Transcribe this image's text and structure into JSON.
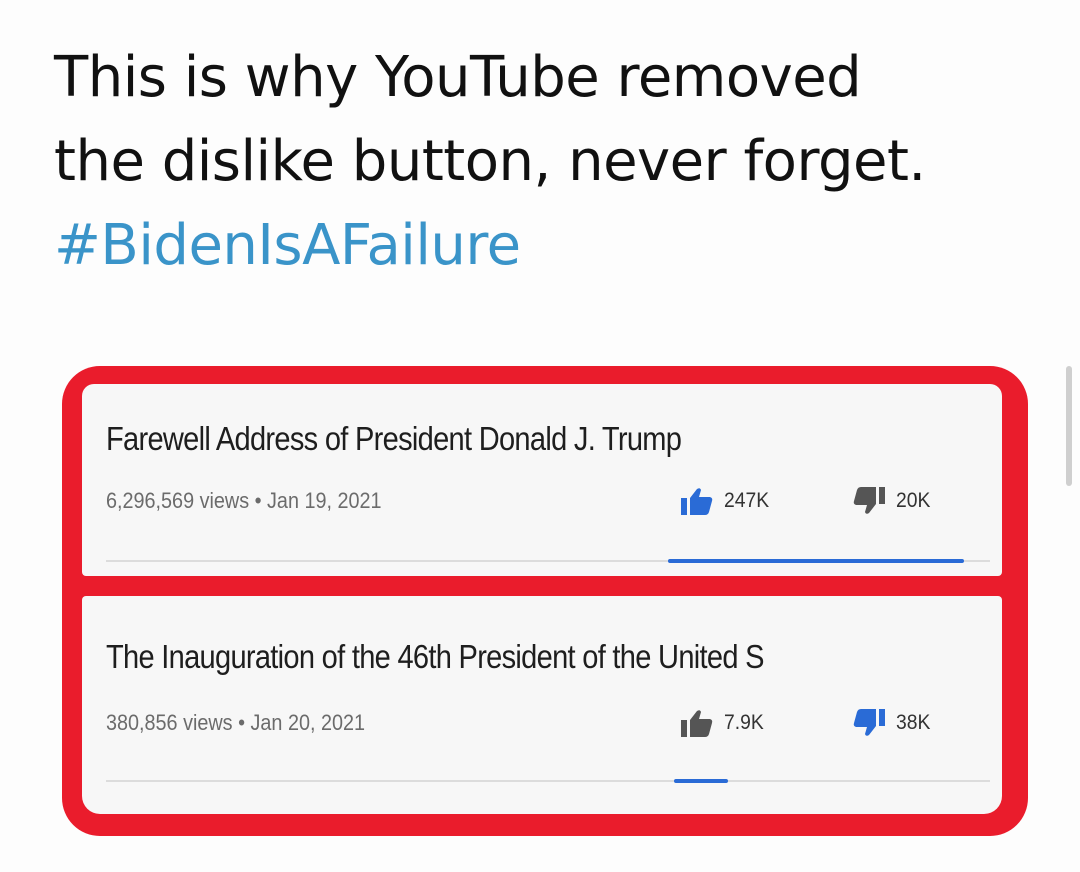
{
  "tweet": {
    "line1": "This is why YouTube removed",
    "line2": "the dislike button, never forget.",
    "hashtag": "#BidenIsAFailure"
  },
  "videos": [
    {
      "title": "Farewell Address of President Donald J. Trump",
      "meta": "6,296,569 views • Jan 19, 2021",
      "likes": "247K",
      "dislikes": "20K",
      "like_ratio": 0.93
    },
    {
      "title": "The Inauguration of the 46th President of the United S",
      "meta": "380,856 views • Jan 20, 2021",
      "likes": "7.9K",
      "dislikes": "38K",
      "like_ratio": 0.17
    }
  ],
  "colors": {
    "highlight_frame": "#ea1c2c",
    "hashtag": "#3a94c9",
    "ratio_bar": "#2a6bd6"
  },
  "icons": {
    "like": "thumbs-up-icon",
    "dislike": "thumbs-down-icon"
  }
}
